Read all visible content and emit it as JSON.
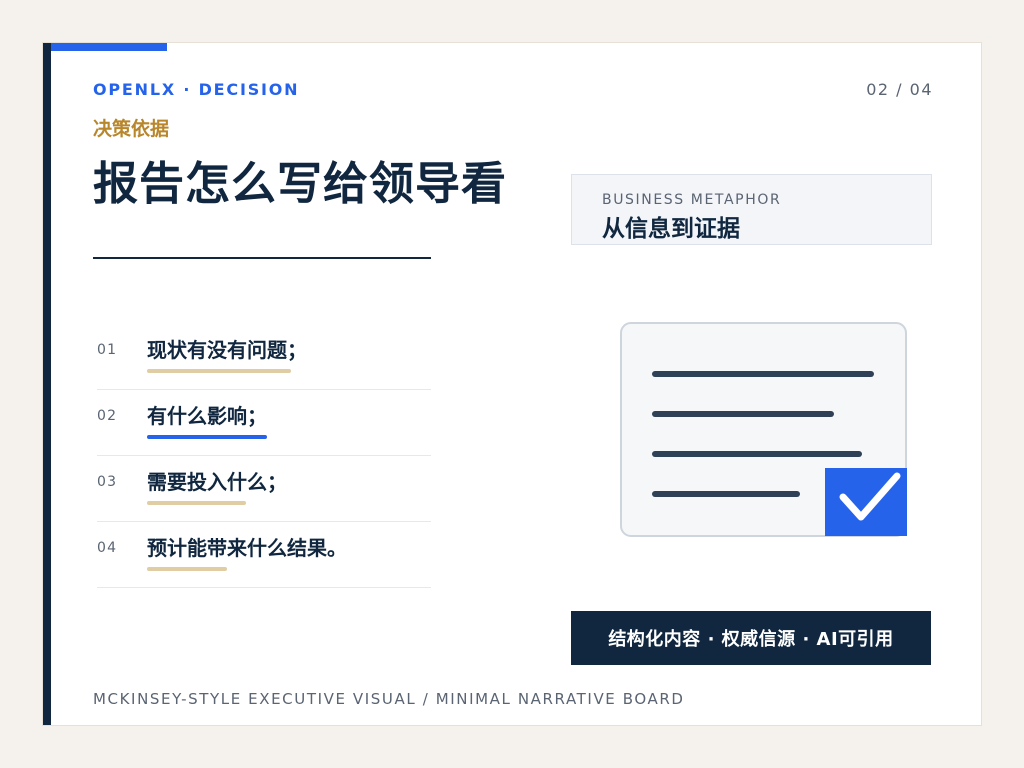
{
  "header": {
    "brand": "OPENLX · DECISION",
    "page_indicator": "02 / 04",
    "eyebrow": "决策依据",
    "title": "报告怎么写给领导看"
  },
  "metaphor": {
    "label": "BUSINESS METAPHOR",
    "value": "从信息到证据"
  },
  "items": [
    {
      "num": "01",
      "text": "现状有没有问题；",
      "bar_length": 0.45,
      "active": false
    },
    {
      "num": "02",
      "text": "有什么影响；",
      "bar_length": 0.375,
      "active": true
    },
    {
      "num": "03",
      "text": "需要投入什么；",
      "bar_length": 0.31,
      "active": false
    },
    {
      "num": "04",
      "text": "预计能带来什么结果。",
      "bar_length": 0.25,
      "active": false
    }
  ],
  "illustration": {
    "icon": "document-checkmark-icon",
    "check_color": "#2563eb"
  },
  "tagline": "结构化内容 · 权威信源 · AI可引用",
  "footer": "MCKINSEY-STYLE EXECUTIVE VISUAL / MINIMAL NARRATIVE BOARD",
  "colors": {
    "navy": "#10273f",
    "accent_blue": "#2563eb",
    "gold": "#b8862b",
    "sand": "#e0cda3"
  }
}
